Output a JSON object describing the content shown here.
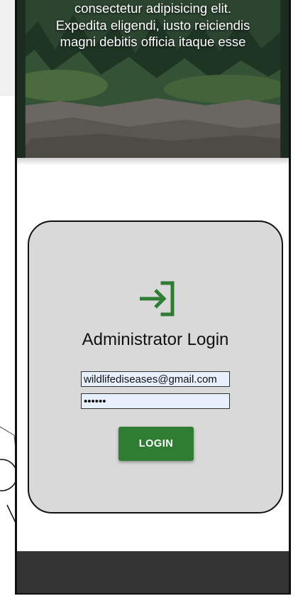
{
  "hero": {
    "lines": [
      "consectetur adipisicing elit.",
      "Expedita eligendi, iusto reiciendis",
      "magni debitis officia itaque esse"
    ]
  },
  "login": {
    "icon": "login-arrow-icon",
    "title": "Administrator Login",
    "email_value": "wildlifediseases@gmail.com",
    "password_value": "••••••",
    "button_label": "LOGIN"
  },
  "colors": {
    "accent": "#2e7d32",
    "card": "#d9d9d9",
    "footer": "#333333",
    "input_autofill": "#e8f0fe"
  }
}
